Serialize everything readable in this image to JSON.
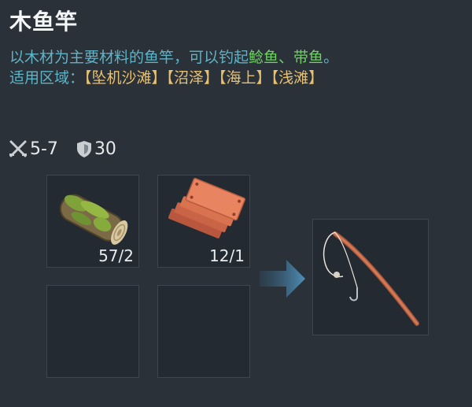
{
  "item": {
    "title": "木鱼竿",
    "desc_prefix": "以木材为主要材料的鱼竿，可以钓起",
    "fish_1": "鲶鱼",
    "fish_sep": "、",
    "fish_2": "带鱼",
    "desc_suffix": "。",
    "region_label": "适用区域：",
    "regions": [
      "【坠机沙滩】",
      "【沼泽】",
      "【海上】",
      "【浅滩】"
    ]
  },
  "stats": {
    "attack": "5-7",
    "durability": "30",
    "attack_icon": "crossed-swords-icon",
    "durability_icon": "shield-icon"
  },
  "recipe": {
    "ingredients": [
      {
        "name": "wood-log",
        "qty": "57/2"
      },
      {
        "name": "copper-plates",
        "qty": "12/1"
      }
    ],
    "result": "fishing-rod"
  },
  "colors": {
    "background": "#2b3138",
    "description": "#5fb3c6",
    "fish_highlight": "#6fd063",
    "region_highlight": "#e8c070"
  }
}
